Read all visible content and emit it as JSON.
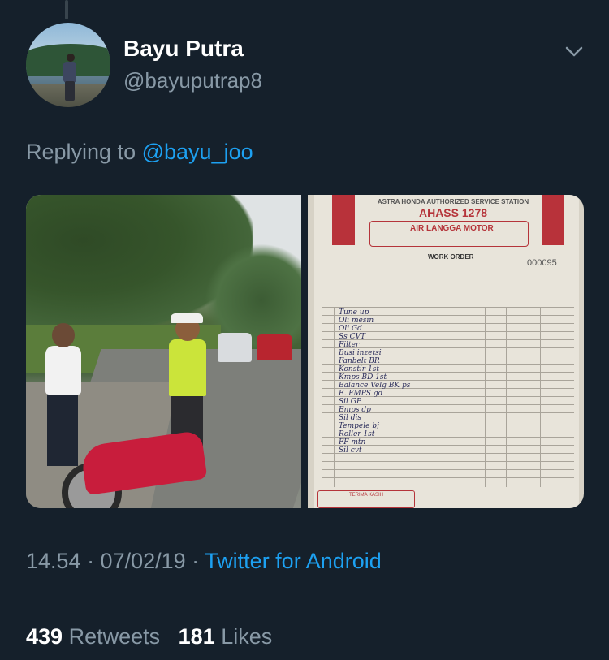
{
  "tweet": {
    "author": {
      "display_name": "Bayu Putra",
      "handle": "@bayuputrap8"
    },
    "reply": {
      "prefix": "Replying to",
      "mention": "@bayu_joo"
    },
    "timestamp": "14.54 · 07/02/19 ·",
    "source": "Twitter for Android",
    "stats": {
      "retweets_count": "439",
      "retweets_label": "Retweets",
      "likes_count": "181",
      "likes_label": "Likes"
    }
  },
  "receipt": {
    "header": "ASTRA HONDA AUTHORIZED SERVICE STATION",
    "ahass": "AHASS 1278",
    "dealer": "AIR LANGGA MOTOR",
    "work_order": "WORK ORDER",
    "number": "000095",
    "thanks": "TERIMA KASIH",
    "rows": [
      "Tune up",
      "Oli mesin",
      "Oli Gd",
      "Ss CVT",
      "Filter",
      "Busi inzetsi",
      "Fanbelt BR",
      "Konstir 1st",
      "Kmps BD 1st",
      "Balance Velg BK ps",
      "E. FMPS gd",
      "Sil GP",
      "Emps dp",
      "Sil dis",
      "Tempele bj",
      "Roller 1st",
      "FF mtn",
      "Sil cvt"
    ]
  },
  "colors": {
    "background": "#15202b",
    "link": "#1da1f2",
    "muted": "#8899a6"
  }
}
